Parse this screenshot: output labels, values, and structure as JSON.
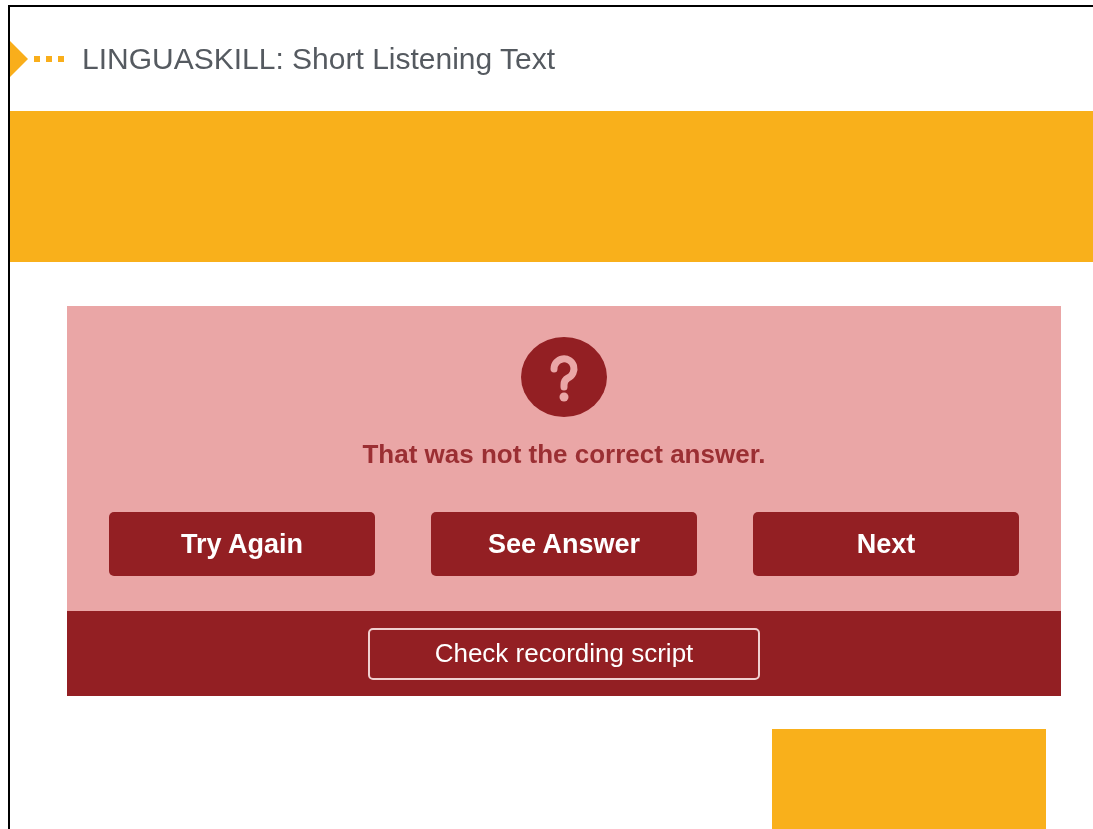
{
  "header": {
    "title": "LINGUASKILL: Short Listening Text"
  },
  "feedback": {
    "message": "That was not the correct answer.",
    "buttons": [
      "Try Again",
      "See Answer",
      "Next"
    ],
    "script_button": "Check recording script"
  }
}
